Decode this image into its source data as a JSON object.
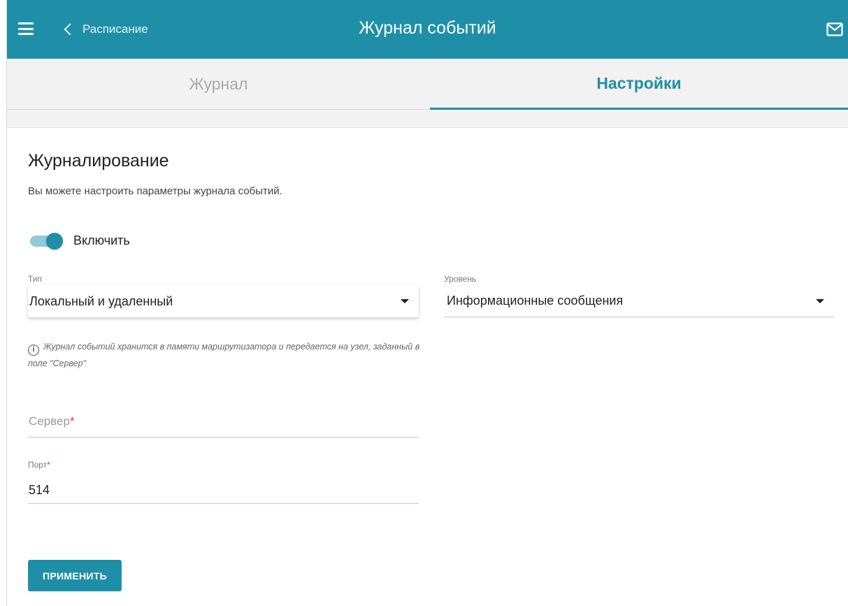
{
  "header": {
    "back_label": "Расписание",
    "title": "Журнал событий",
    "menu_icon": "hamburger-icon",
    "mail_icon": "mail-icon"
  },
  "tabs": [
    {
      "label": "Журнал",
      "active": false
    },
    {
      "label": "Настройки",
      "active": true
    }
  ],
  "section": {
    "title": "Журналирование",
    "description": "Вы можете настроить параметры журнала событий."
  },
  "enable_toggle": {
    "label": "Включить",
    "on": true
  },
  "type_select": {
    "label": "Тип",
    "value": "Локальный и удаленный"
  },
  "level_select": {
    "label": "Уровень",
    "value": "Информационные сообщения"
  },
  "hint": {
    "text": "Журнал событий хранится в памяти маршрутизатора и передается на узел, заданный в поле \"Сервер\""
  },
  "server_field": {
    "placeholder": "Сервер",
    "required_mark": "*",
    "value": ""
  },
  "port_field": {
    "label": "Порт",
    "required_mark": "*",
    "value": "514"
  },
  "apply_button": {
    "label": "ПРИМЕНИТЬ"
  },
  "colors": {
    "accent": "#1f8fa8",
    "required": "#e53935"
  }
}
